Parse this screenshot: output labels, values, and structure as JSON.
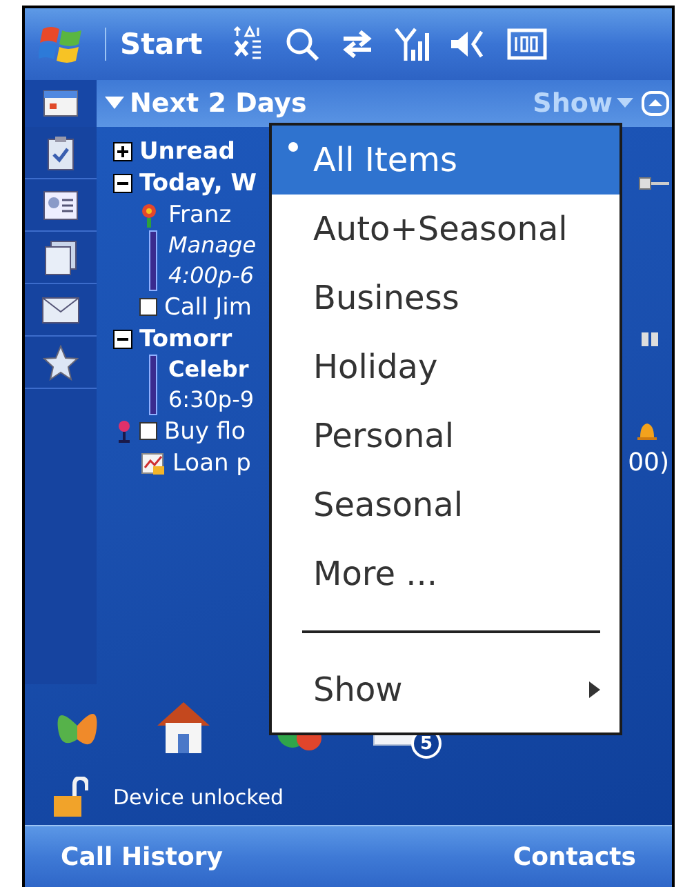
{
  "top_bar": {
    "start": "Start"
  },
  "header": {
    "title": "Next 2 Days",
    "show": "Show"
  },
  "agenda": [
    {
      "kind": "group",
      "text": "Unread",
      "expanded": false
    },
    {
      "kind": "group",
      "text": "Today, W",
      "expanded": true
    },
    {
      "kind": "birthday",
      "text": "Franz"
    },
    {
      "kind": "appointment",
      "title": "Manage",
      "time": "4:00p-6",
      "italic": true
    },
    {
      "kind": "task",
      "text": "Call Jim",
      "checked": false
    },
    {
      "kind": "group",
      "text": "Tomorr",
      "expanded": true
    },
    {
      "kind": "appointment",
      "title": "Celebr",
      "time": "6:30p-9",
      "italic": false
    },
    {
      "kind": "task",
      "text": "Buy flo",
      "checked": false,
      "priority": true,
      "reminder": true
    },
    {
      "kind": "loan",
      "text": "Loan p",
      "trailing": "00)"
    }
  ],
  "menu": [
    {
      "kind": "item",
      "label": "All Items",
      "selected": true
    },
    {
      "kind": "item",
      "label": "Auto+Seasonal",
      "selected": false
    },
    {
      "kind": "item",
      "label": "Business",
      "selected": false
    },
    {
      "kind": "item",
      "label": "Holiday",
      "selected": false
    },
    {
      "kind": "item",
      "label": "Personal",
      "selected": false
    },
    {
      "kind": "item",
      "label": "Seasonal",
      "selected": false
    },
    {
      "kind": "item",
      "label": "More ...",
      "selected": false
    },
    {
      "kind": "separator"
    },
    {
      "kind": "submenu",
      "label": "Show",
      "selected": false
    }
  ],
  "launcher": {
    "badge": "5"
  },
  "lock_status": "Device unlocked",
  "softkeys": [
    "Call History",
    "Contacts"
  ]
}
